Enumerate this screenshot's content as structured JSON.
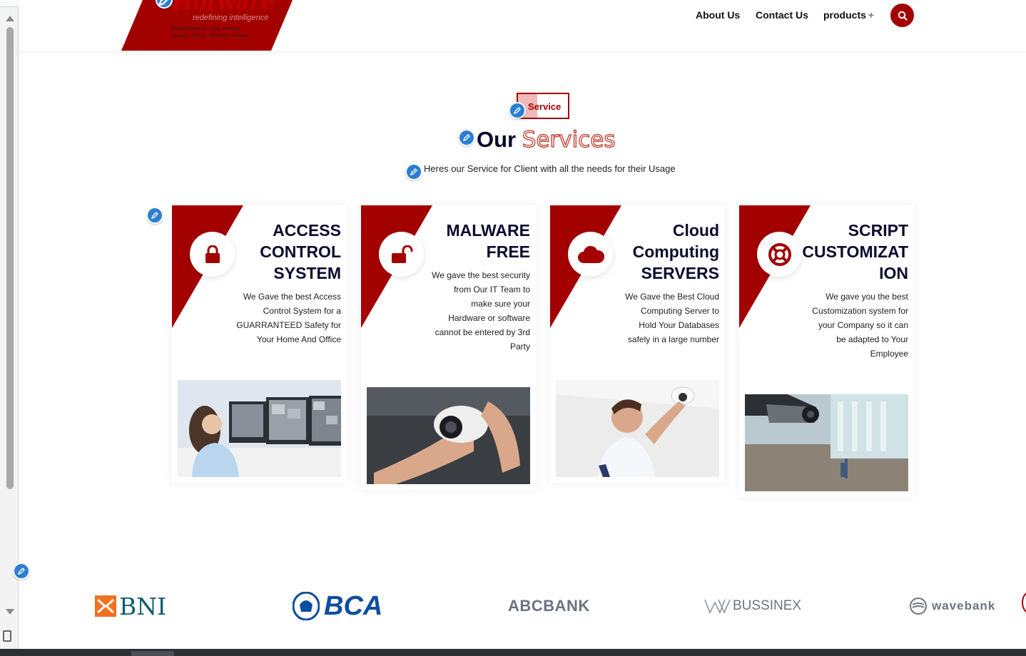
{
  "header": {
    "logo": {
      "brand": "Hotware",
      "tagline": "redefining intelligence",
      "line1": "Silocket Indonesia · Onlix · Redware",
      "line2": "Gasveno · IOTcok · Vanderbilt · Ax Optic"
    },
    "nav": [
      {
        "label": "About Us"
      },
      {
        "label": "Contact Us"
      },
      {
        "label": "products"
      }
    ],
    "products_plus": "+",
    "search_icon": "search-icon"
  },
  "section": {
    "tag": "Service",
    "title_part1": "Our",
    "title_part2": "Services",
    "subtitle": "Heres our Service for Client with all the needs for their Usage"
  },
  "cards": [
    {
      "icon": "lock-icon",
      "title_lines": [
        "ACCESS",
        "CONTROL",
        "SYSTEM"
      ],
      "desc_lines": [
        "We Gave the best Access",
        "Control System for a",
        "GUARRANTEED Safety for",
        "Your Home And Office"
      ],
      "image": "woman-monitoring-cctv-screens"
    },
    {
      "icon": "unlock-icon",
      "title_lines": [
        "MALWARE",
        "FREE"
      ],
      "desc_lines": [
        "We gave the best security",
        "from Our IT Team to",
        "make sure your",
        "Hardware or software",
        "cannot be entered by 3rd",
        "Party"
      ],
      "image": "hands-holding-security-camera"
    },
    {
      "icon": "cloud-icon",
      "title_lines": [
        "Cloud",
        "Computing",
        "SERVERS"
      ],
      "desc_lines": [
        "We Gave the Best Cloud",
        "Computing Server to",
        "Hold Your Databases",
        "safely in a large number"
      ],
      "image": "technician-installing-dome-camera"
    },
    {
      "icon": "lifebuoy-icon",
      "title_lines": [
        "SCRIPT",
        "CUSTOMIZAT",
        "ION"
      ],
      "desc_lines": [
        "We gave you the best",
        "Customization system for",
        "your Company so it can",
        "be adapted to Your",
        "Employee"
      ],
      "image": "cctv-camera-in-lobby"
    }
  ],
  "banks": [
    {
      "name": "BNI"
    },
    {
      "name": "BCA"
    },
    {
      "name": "ABCBANK"
    },
    {
      "name": "BUSSINEX"
    },
    {
      "name": "wavebank"
    }
  ],
  "colors": {
    "accent": "#a30000",
    "navy": "#0b0b30",
    "edit_badge": "#2a7fd4"
  }
}
